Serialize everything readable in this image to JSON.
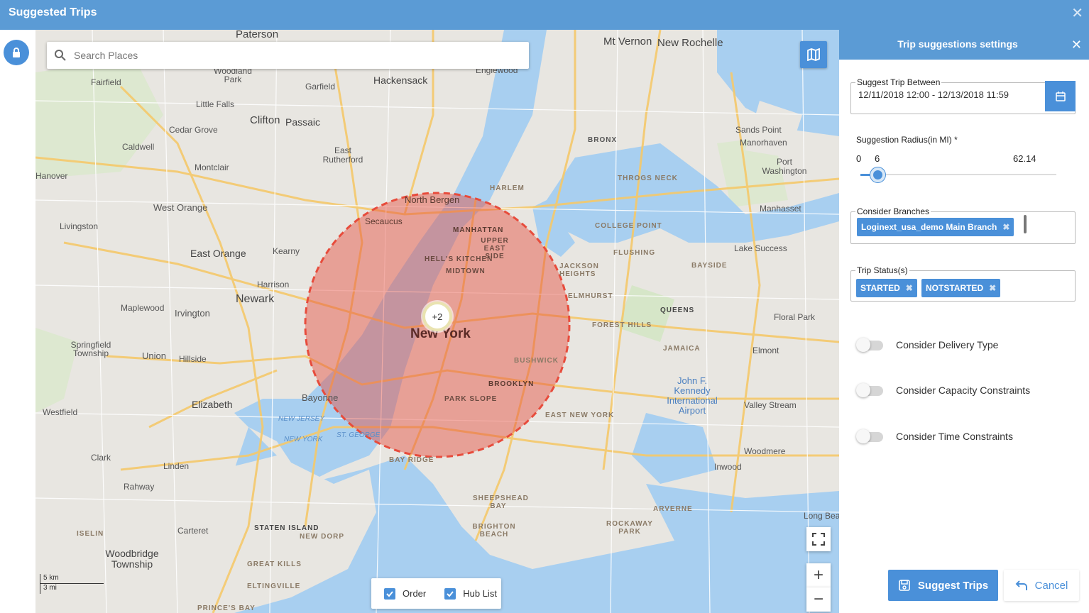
{
  "window": {
    "title": "Suggested Trips",
    "close_icon": "close-icon"
  },
  "map": {
    "search_placeholder": "Search Places",
    "cluster_label": "+2",
    "layers": {
      "order_label": "Order",
      "hub_label": "Hub List",
      "order_checked": true,
      "hub_checked": true
    },
    "scale": {
      "km": "5 km",
      "mi": "3 mi"
    },
    "zoom_in": "+",
    "zoom_out": "−",
    "radius_circle_color": "#e74c3c",
    "labels": {
      "paterson": "Paterson",
      "mtvernon": "Mt Vernon",
      "newrochelle": "New Rochelle",
      "fairfield": "Fairfield",
      "woodland": "Woodland Park",
      "garfield": "Garfield",
      "hackensack": "Hackensack",
      "englewood": "Englewood",
      "littlefalls": "Little Falls",
      "clifton": "Clifton",
      "passaic": "Passaic",
      "cedargrove": "Cedar Grove",
      "caldwell": "Caldwell",
      "eastrutherford": "East Rutherford",
      "sandspoint": "Sands Point",
      "manorhaven": "Manorhaven",
      "portwashington": "Port Washington",
      "hanover": "Hanover",
      "montclair": "Montclair",
      "westorange": "West Orange",
      "livingston": "Livingston",
      "eastorange": "East Orange",
      "kearny": "Kearny",
      "harrison": "Harrison",
      "newark": "Newark",
      "maplewood": "Maplewood",
      "irvington": "Irvington",
      "springfield": "Springfield Township",
      "union": "Union",
      "hillside": "Hillside",
      "elizabeth": "Elizabeth",
      "bayonne": "Bayonne",
      "westfield": "Westfield",
      "clark": "Clark",
      "linden": "Linden",
      "rahway": "Rahway",
      "carteret": "Carteret",
      "woodbridge": "Woodbridge Township",
      "northbergen": "North Bergen",
      "secaucus": "Secaucus",
      "manhattan": "MANHATTAN",
      "uppereastside": "UPPER EAST SIDE",
      "hellskitchen": "HELL'S KITCHEN",
      "midtown": "MIDTOWN",
      "newyork": "New York",
      "harlem": "HARLEM",
      "bronx": "BRONX",
      "throgsneck": "THROGS NECK",
      "collegepoint": "COLLEGE POINT",
      "flushing": "FLUSHING",
      "jacksonheights": "JACKSON HEIGHTS",
      "elmhurst": "ELMHURST",
      "queens": "QUEENS",
      "foresthills": "FOREST HILLS",
      "jamaica": "JAMAICA",
      "bushwick": "BUSHWICK",
      "brooklyn": "BROOKLYN",
      "parkslope": "PARK SLOPE",
      "eastnewyork": "EAST NEW YORK",
      "bayridge": "BAY RIDGE",
      "sheepshead": "SHEEPSHEAD BAY",
      "brighton": "BRIGHTON BEACH",
      "rockaway": "ROCKAWAY PARK",
      "arverne": "ARVERNE",
      "statenisland": "STATEN ISLAND",
      "newdorp": "NEW DORP",
      "greatkills": "GREAT KILLS",
      "eltingville": "ELTINGVILLE",
      "princesbay": "PRINCE'S BAY",
      "iselin": "ISELIN",
      "manhasset": "Manhasset",
      "lakesuccess": "Lake Success",
      "bayside": "BAYSIDE",
      "floralpark": "Floral Park",
      "elmont": "Elmont",
      "valleystream": "Valley Stream",
      "woodmere": "Woodmere",
      "inwood": "Inwood",
      "longbeach": "Long Bea",
      "jfk": "John F. Kennedy International Airport",
      "newjersey": "NEW JERSEY",
      "newyorkstate": "NEW YORK",
      "stgeorge": "ST. GEORGE"
    }
  },
  "settings": {
    "title": "Trip suggestions settings",
    "close_icon": "close-icon",
    "suggest_between_label": "Suggest Trip Between",
    "date_range": "12/11/2018 12:00 - 12/13/2018 11:59",
    "radius_label": "Suggestion Radius(in MI) *",
    "radius_min": "0",
    "radius_value": "6",
    "radius_max": "62.14",
    "radius_fraction": 0.0966,
    "branches_label": "Consider Branches",
    "branches": [
      "Loginext_usa_demo Main Branch"
    ],
    "status_label": "Trip Status(s)",
    "statuses": [
      "STARTED",
      "NOTSTARTED"
    ],
    "toggles": [
      {
        "label": "Consider Delivery Type",
        "on": false
      },
      {
        "label": "Consider Capacity Constraints",
        "on": false
      },
      {
        "label": "Consider Time Constraints",
        "on": false
      }
    ],
    "suggest_button": "Suggest Trips",
    "cancel_button": "Cancel",
    "accent_color": "#4a90d9",
    "header_color": "#5b9bd5"
  }
}
